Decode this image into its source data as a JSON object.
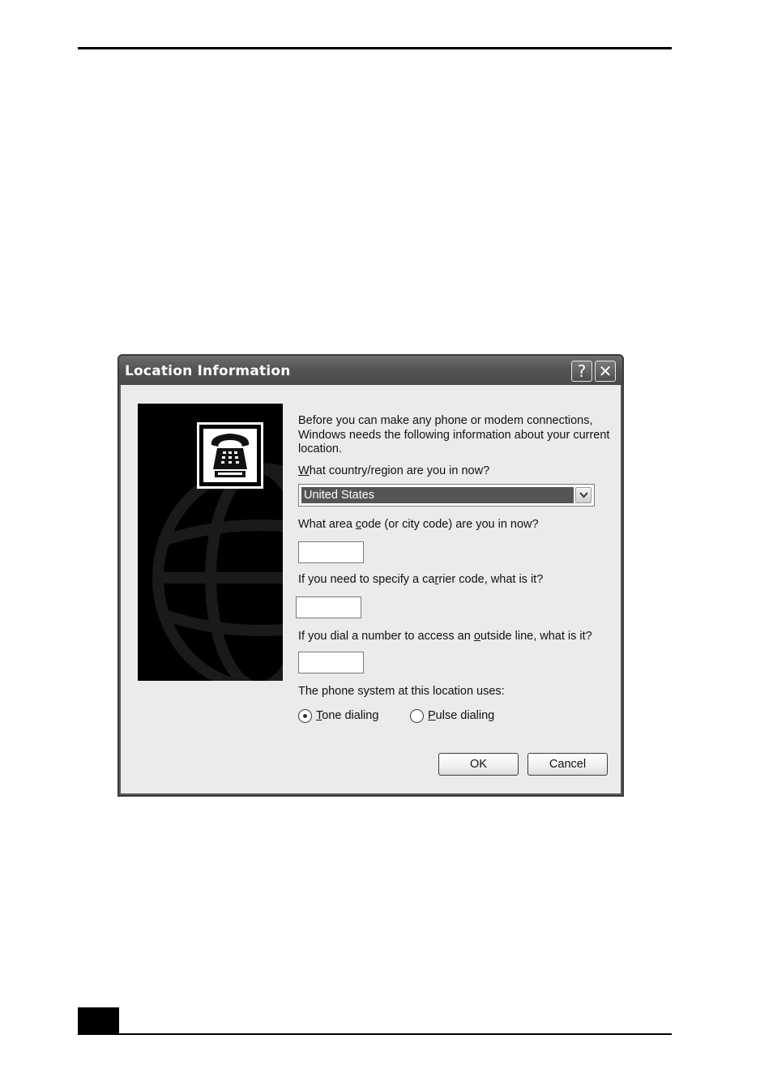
{
  "dialog": {
    "title": "Location Information",
    "help_glyph": "?",
    "close_glyph": "✕",
    "intro": "Before you can make any phone or modem connections, Windows needs the following information about your current location.",
    "country_question": {
      "hotkey": "W",
      "rest": "hat country/region are you in now?"
    },
    "country_value": "United States",
    "area_question": {
      "pre": "What area ",
      "hotkey": "c",
      "post": "ode (or city code) are you in now?"
    },
    "area_value": "",
    "carrier_question": {
      "pre": "If you need to specify a ca",
      "hotkey": "r",
      "post": "rier code, what is it?"
    },
    "carrier_value": "",
    "outside_question": {
      "pre": "If you dial a number to access an ",
      "hotkey": "o",
      "post": "utside line, what is it?"
    },
    "outside_value": "",
    "phone_system_label": "The phone system at this location uses:",
    "tone": {
      "hotkey": "T",
      "rest": "one dialing",
      "selected": true
    },
    "pulse": {
      "hotkey": "P",
      "rest": "ulse dialing",
      "selected": false
    },
    "ok_label": "OK",
    "cancel_label": "Cancel",
    "side_icon": "telephone-icon",
    "side_background": "globe-graphic"
  },
  "colors": {
    "title_bar": "#545454",
    "client_bg": "#ebebeb",
    "selection": "#555555"
  }
}
